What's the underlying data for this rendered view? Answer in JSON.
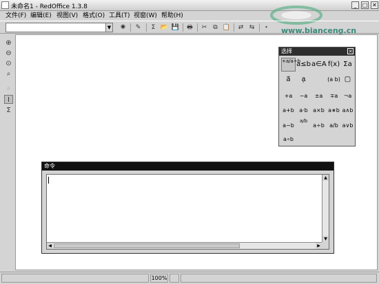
{
  "window": {
    "title": "未命名1 - RedOffice 1.3.8",
    "buttons": {
      "minimize": "_",
      "maximize": "□",
      "close": "✕"
    }
  },
  "watermark": {
    "text": "www.bianceng.cn"
  },
  "menu": [
    "文件(F)",
    "编辑(E)",
    "视图(V)",
    "格式(O)",
    "工具(T)",
    "视窗(W)",
    "帮助(H)"
  ],
  "toolbar": {
    "name_box": {
      "value": "",
      "arrow": "▼"
    },
    "icons": [
      {
        "name": "navigator-icon",
        "glyph": "✺",
        "dim": true
      },
      {
        "name": "edit-file-icon",
        "glyph": "✎",
        "dim": true
      },
      {
        "name": "new-formula-icon",
        "glyph": "Σ",
        "dim": false
      },
      {
        "name": "open-icon",
        "glyph": "📂",
        "dim": false
      },
      {
        "name": "save-icon",
        "glyph": "💾",
        "dim": false
      },
      {
        "name": "print-icon",
        "glyph": "🖶",
        "dim": false
      },
      {
        "name": "cut-icon",
        "glyph": "✂",
        "dim": true
      },
      {
        "name": "copy-icon",
        "glyph": "⧉",
        "dim": false
      },
      {
        "name": "paste-icon",
        "glyph": "📋",
        "dim": false
      },
      {
        "name": "undo-icon",
        "glyph": "⇄",
        "dim": true
      },
      {
        "name": "redo-icon",
        "glyph": "⇆",
        "dim": true
      },
      {
        "name": "extra-icon",
        "glyph": "⋆",
        "dim": true
      }
    ]
  },
  "left_tools": [
    {
      "name": "zoom-in-icon",
      "glyph": "⊕"
    },
    {
      "name": "zoom-out-icon",
      "glyph": "⊖"
    },
    {
      "name": "zoom-100-icon",
      "glyph": "⊙"
    },
    {
      "name": "show-all-icon",
      "glyph": "⌕"
    },
    {
      "name": "update-icon",
      "glyph": "⌕"
    },
    {
      "name": "cursor-icon",
      "glyph": "I"
    },
    {
      "name": "symbols-icon",
      "glyph": "Σ"
    }
  ],
  "selection_panel": {
    "title": "选择",
    "close": "✕",
    "categories_row1": [
      "+a/a÷b",
      "a≤b",
      "a∈A",
      "f(x)",
      "Σa"
    ],
    "categories_row2": [
      "a⃗",
      "a᷊",
      "",
      "(a b)",
      "▢"
    ],
    "operators": [
      [
        "+a",
        "−a",
        "±a",
        "∓a",
        "¬a"
      ],
      [
        "a+b",
        "a·b",
        "a×b",
        "a∗b",
        "a∧b"
      ],
      [
        "a−b",
        "a/b",
        "a÷b",
        "a/b",
        "a∨b"
      ],
      [
        "a∘b",
        "",
        "",
        "",
        ""
      ]
    ]
  },
  "command": {
    "title": "命令",
    "text": ""
  },
  "status": {
    "zoom": "100%"
  }
}
